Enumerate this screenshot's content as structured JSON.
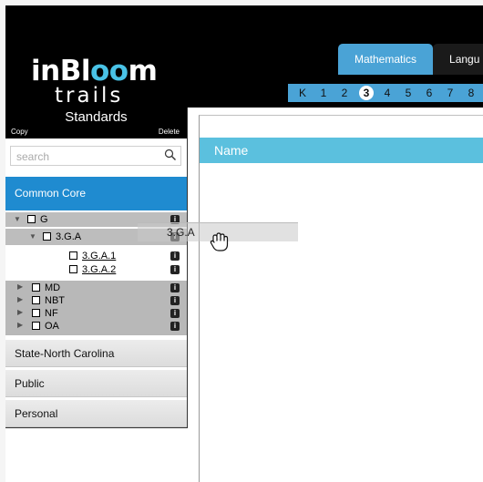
{
  "logo": {
    "line1_a": "inBl",
    "line1_b": "o",
    "line1_c": "o",
    "line1_d": "m",
    "line2": "trails"
  },
  "subject_tabs": [
    "Mathematics",
    "Langu"
  ],
  "grades": [
    "K",
    "1",
    "2",
    "3",
    "4",
    "5",
    "6",
    "7",
    "8"
  ],
  "active_grade": "3",
  "sidebar": {
    "title": "Standards",
    "copy_label": "Copy",
    "delete_label": "Delete",
    "search_placeholder": "search",
    "sections": {
      "common_core": "Common Core",
      "state": "State-North Carolina",
      "public": "Public",
      "personal": "Personal"
    },
    "tree": {
      "g": "G",
      "g3a": "3.G.A",
      "g3a1": "3.G.A.1",
      "g3a2": "3.G.A.2",
      "md": "MD",
      "nbt": "NBT",
      "nf": "NF",
      "oa": "OA",
      "info": "i"
    }
  },
  "drag": {
    "label": "3.G.A"
  },
  "content": {
    "header": "Name"
  },
  "colors": {
    "accent": "#4aa3d6",
    "common_core": "#1f8bd0",
    "header": "#5bc0de"
  }
}
